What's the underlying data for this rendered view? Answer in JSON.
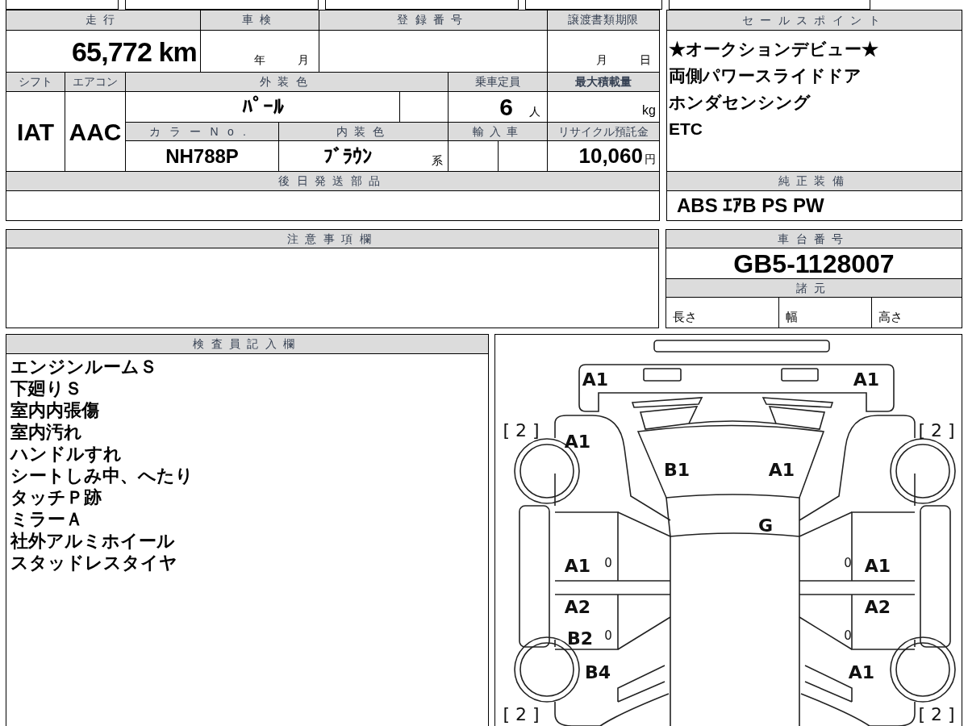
{
  "mileage": {
    "label": "走行",
    "value": "65,772",
    "unit": "km"
  },
  "inspection": {
    "label": "車検",
    "year_unit": "年",
    "month_unit": "月"
  },
  "registration_number": {
    "label": "登録番号"
  },
  "transfer_deadline": {
    "label": "譲渡書類期限",
    "month_unit": "月",
    "day_unit": "日"
  },
  "shift": {
    "label": "シフト",
    "value": "IAT"
  },
  "aircon": {
    "label": "エアコン",
    "value": "AAC"
  },
  "exterior_color": {
    "label": "外装色",
    "value": "ﾊﾟｰﾙ"
  },
  "capacity": {
    "label": "乗車定員",
    "value": "6",
    "unit": "人"
  },
  "max_load": {
    "label": "最大積載量",
    "unit": "kg"
  },
  "color_no": {
    "label": "カラーNo.",
    "value": "NH788P"
  },
  "interior_color": {
    "label": "内装色",
    "value": "ﾌﾞﾗｳﾝ",
    "suffix": "系"
  },
  "imported": {
    "label": "輸入車"
  },
  "recycle_fee": {
    "label": "リサイクル預託金",
    "value": "10,060",
    "unit": "円"
  },
  "later_parts": {
    "label": "後日発送部品"
  },
  "sales_points": {
    "label": "セールスポイント",
    "items": [
      "★オークションデビュー★",
      "両側パワースライドドア",
      "ホンダセンシング",
      "ETC"
    ]
  },
  "standard_equipment": {
    "label": "純正装備",
    "value": "ABS ｴｱB PS PW"
  },
  "notes": {
    "label": "注意事項欄"
  },
  "chassis": {
    "label": "車台番号",
    "value": "GB5-1128007"
  },
  "specs": {
    "label": "諸元",
    "items": [
      "長さ",
      "幅",
      "高さ"
    ]
  },
  "inspector_notes": {
    "label": "検査員記入欄",
    "items": [
      "エンジンルームＳ",
      "下廻りＳ",
      "室内内張傷",
      "室内汚れ",
      "ハンドルすれ",
      "シートしみ中、へたり",
      "タッチＰ跡",
      "ミラーＡ",
      "社外アルミホイール",
      "スタッドレスタイヤ"
    ]
  },
  "damage_map": {
    "marks": [
      {
        "kind": "grade",
        "text": "A1"
      },
      {
        "kind": "grade",
        "text": "A1"
      },
      {
        "kind": "tire",
        "text": "[ 2 ]"
      },
      {
        "kind": "tire",
        "text": "[ 2 ]"
      },
      {
        "kind": "grade",
        "text": "A1"
      },
      {
        "kind": "grade",
        "text": "B1"
      },
      {
        "kind": "grade",
        "text": "A1"
      },
      {
        "kind": "grade",
        "text": "G"
      },
      {
        "kind": "grade",
        "text": "A1"
      },
      {
        "kind": "paint",
        "text": "0"
      },
      {
        "kind": "paint",
        "text": "0"
      },
      {
        "kind": "grade",
        "text": "A1"
      },
      {
        "kind": "grade",
        "text": "A2"
      },
      {
        "kind": "grade",
        "text": "A2"
      },
      {
        "kind": "grade",
        "text": "B2"
      },
      {
        "kind": "paint",
        "text": "0"
      },
      {
        "kind": "paint",
        "text": "0"
      },
      {
        "kind": "grade",
        "text": "B4"
      },
      {
        "kind": "grade",
        "text": "A1"
      },
      {
        "kind": "tire",
        "text": "[ 2 ]"
      },
      {
        "kind": "tire",
        "text": "[ 2 ]"
      }
    ]
  }
}
